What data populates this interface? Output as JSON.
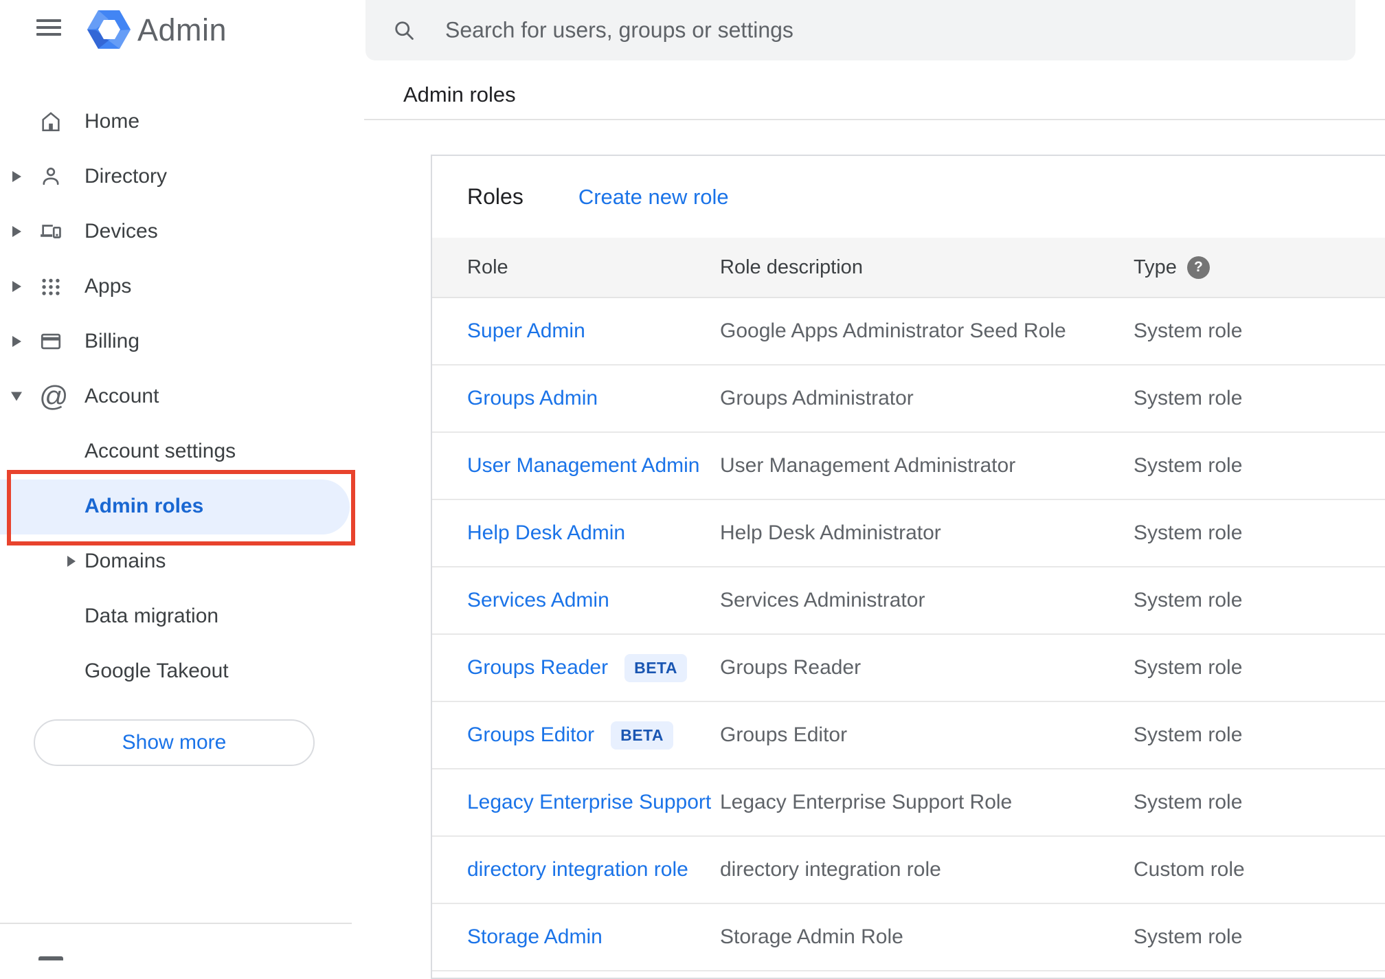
{
  "app": {
    "name": "Admin",
    "logo_icon": "admin-hexagon-logo",
    "menu_icon": "hamburger-menu-icon"
  },
  "search": {
    "placeholder": "Search for users, groups or settings",
    "icon": "search-icon"
  },
  "breadcrumb": "Admin roles",
  "sidebar": {
    "items": [
      {
        "label": "Home",
        "icon": "home-icon",
        "expandable": false
      },
      {
        "label": "Directory",
        "icon": "person-icon",
        "expandable": true
      },
      {
        "label": "Devices",
        "icon": "devices-icon",
        "expandable": true
      },
      {
        "label": "Apps",
        "icon": "apps-grid-icon",
        "expandable": true
      },
      {
        "label": "Billing",
        "icon": "credit-card-icon",
        "expandable": true
      },
      {
        "label": "Account",
        "icon": "at-sign-icon",
        "expandable": true,
        "expanded": true
      }
    ],
    "account_subitems": [
      {
        "label": "Account settings"
      },
      {
        "label": "Admin roles",
        "selected": true,
        "annotated": true
      },
      {
        "label": "Domains",
        "expandable": true
      },
      {
        "label": "Data migration"
      },
      {
        "label": "Google Takeout"
      }
    ],
    "show_more_label": "Show more"
  },
  "card": {
    "title": "Roles",
    "create_link": "Create new role",
    "table": {
      "headers": {
        "role": "Role",
        "description": "Role description",
        "type": "Type"
      },
      "type_help_icon": "question-mark-help-icon",
      "rows": [
        {
          "role": "Super Admin",
          "description": "Google Apps Administrator Seed Role",
          "type": "System role"
        },
        {
          "role": "Groups Admin",
          "description": "Groups Administrator",
          "type": "System role"
        },
        {
          "role": "User Management Admin",
          "description": "User Management Administrator",
          "type": "System role"
        },
        {
          "role": "Help Desk Admin",
          "description": "Help Desk Administrator",
          "type": "System role"
        },
        {
          "role": "Services Admin",
          "description": "Services Administrator",
          "type": "System role"
        },
        {
          "role": "Groups Reader",
          "badge": "BETA",
          "description": "Groups Reader",
          "type": "System role"
        },
        {
          "role": "Groups Editor",
          "badge": "BETA",
          "description": "Groups Editor",
          "type": "System role"
        },
        {
          "role": "Legacy Enterprise Support",
          "description": "Legacy Enterprise Support Role",
          "type": "System role"
        },
        {
          "role": "directory integration role",
          "description": "directory integration role",
          "type": "Custom role"
        },
        {
          "role": "Storage Admin",
          "description": "Storage Admin Role",
          "type": "System role"
        }
      ]
    }
  },
  "colors": {
    "accent_blue": "#1a73e8",
    "selected_text_blue": "#1967d2",
    "selected_bg": "#e8f0fe",
    "annotation_red": "#e8432d",
    "search_bg": "#f2f3f4",
    "table_header_bg": "#f5f5f5",
    "text_dark": "#202124",
    "text_gray": "#5f6368",
    "divider": "#dadce0",
    "beta_badge_text": "#1a56b2"
  }
}
